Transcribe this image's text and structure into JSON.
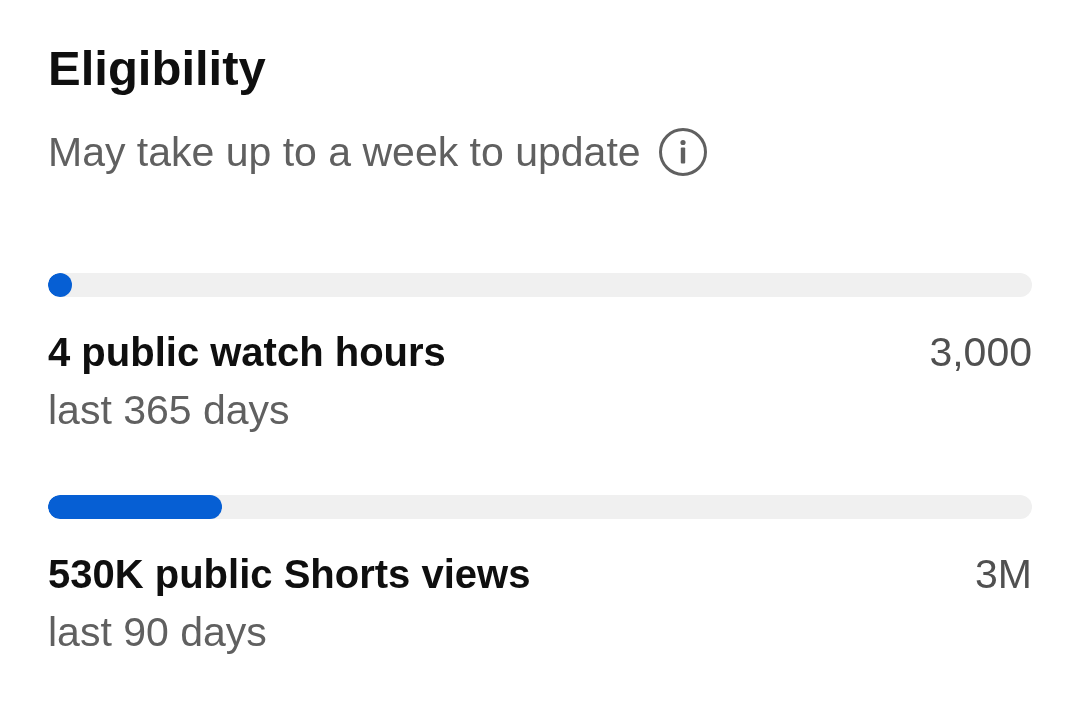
{
  "title": "Eligibility",
  "subtitle": "May take up to a week to update",
  "requirements": [
    {
      "label": "4 public watch hours",
      "target": "3,000",
      "period": "last 365 days",
      "level": 0.0013
    },
    {
      "label": "530K public Shorts views",
      "target": "3M",
      "period": "last 90 days",
      "level": 0.177
    }
  ]
}
